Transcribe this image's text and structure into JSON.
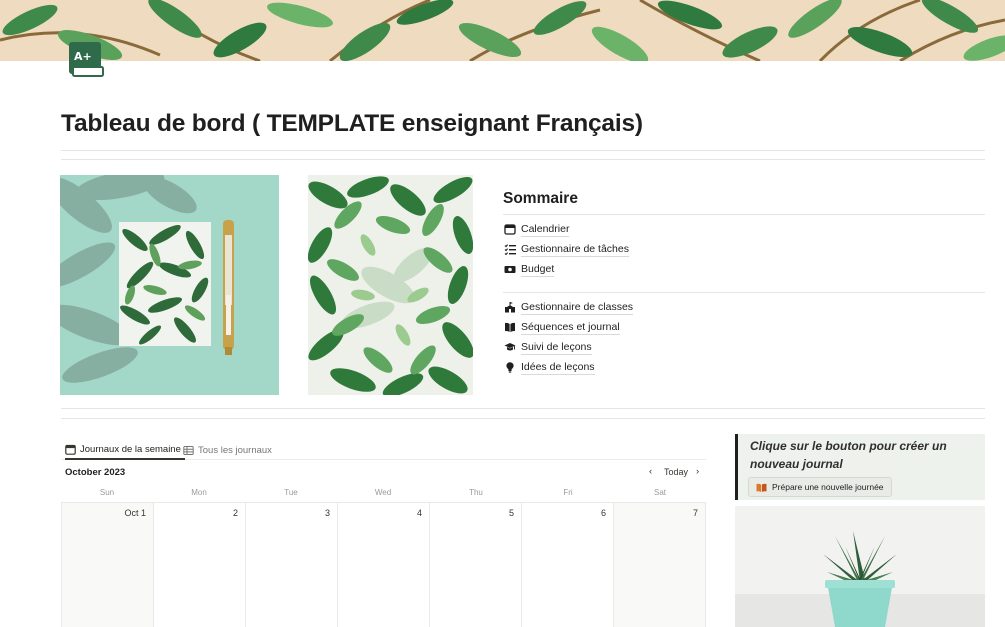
{
  "page": {
    "title": "Tableau de bord ( TEMPLATE enseignant Français)",
    "icon": "a-plus-book-icon"
  },
  "sommaire": {
    "title": "Sommaire",
    "group1": [
      {
        "label": "Calendrier",
        "icon": "calendar-icon"
      },
      {
        "label": "Gestionnaire de tâches",
        "icon": "checklist-icon"
      },
      {
        "label": "Budget",
        "icon": "money-icon"
      }
    ],
    "group2": [
      {
        "label": "Gestionnaire de classes",
        "icon": "school-icon"
      },
      {
        "label": "Séquences et journal",
        "icon": "open-book-icon"
      },
      {
        "label": "Suivi de leçons",
        "icon": "graduation-cap-icon"
      },
      {
        "label": "Idées de leçons",
        "icon": "lightbulb-icon"
      }
    ]
  },
  "tabs": [
    {
      "label": "Journaux de la semaine",
      "icon": "calendar-icon",
      "active": true
    },
    {
      "label": "Tous les journaux",
      "icon": "table-icon",
      "active": false
    }
  ],
  "calendar": {
    "month": "October 2023",
    "today_label": "Today",
    "weekdays": [
      "Sun",
      "Mon",
      "Tue",
      "Wed",
      "Thu",
      "Fri",
      "Sat"
    ],
    "days": [
      "Oct 1",
      "2",
      "3",
      "4",
      "5",
      "6",
      "7"
    ]
  },
  "callout": {
    "text": "Clique sur le bouton pour créer un nouveau journal",
    "button_label": "Prépare une nouvelle journée",
    "button_icon": "book-icon"
  },
  "colors": {
    "accent_green": "#2f6b4a",
    "callout_bg": "#eef2ec",
    "cover_bg": "#efdcc0"
  }
}
